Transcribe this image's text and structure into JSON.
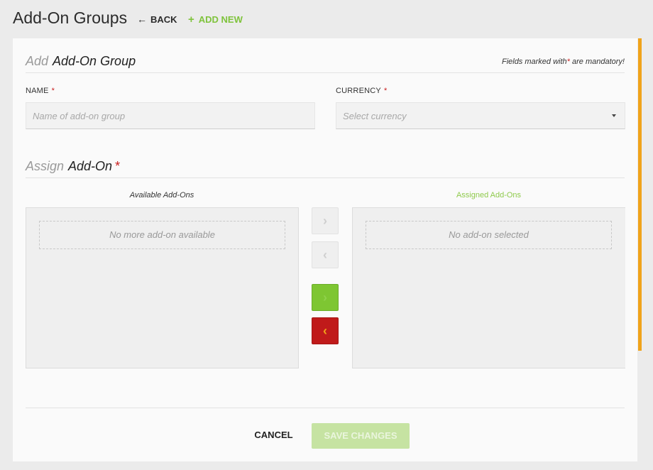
{
  "header": {
    "title": "Add-On Groups",
    "back_label": "BACK",
    "add_new_label": "ADD NEW"
  },
  "form_section": {
    "prefix": "Add",
    "title": "Add-On Group",
    "mandatory_note_prefix": "Fields marked with",
    "mandatory_note_suffix": " are mandatory!"
  },
  "name_field": {
    "label": "NAME",
    "value": "",
    "placeholder": "Name of add-on group"
  },
  "currency_field": {
    "label": "CURRENCY",
    "selected": "Select currency"
  },
  "assign_section": {
    "prefix": "Assign",
    "title": "Add-On",
    "required_mark": "*"
  },
  "available_list": {
    "title": "Available Add-Ons",
    "empty_text": "No more add-on available"
  },
  "assigned_list": {
    "title": "Assigned Add-Ons",
    "empty_text": "No add-on selected"
  },
  "move_buttons": {
    "move_right": "›",
    "move_left": "‹",
    "move_all_right": "›",
    "move_all_left": "‹"
  },
  "footer": {
    "cancel_label": "CANCEL",
    "save_label": "SAVE CHANGES"
  },
  "required_star": "*",
  "colors": {
    "accent_green": "#7ec632",
    "danger_red": "#c01a1a",
    "required_red": "#c81d1d",
    "scroll_orange": "#f0a31a"
  }
}
